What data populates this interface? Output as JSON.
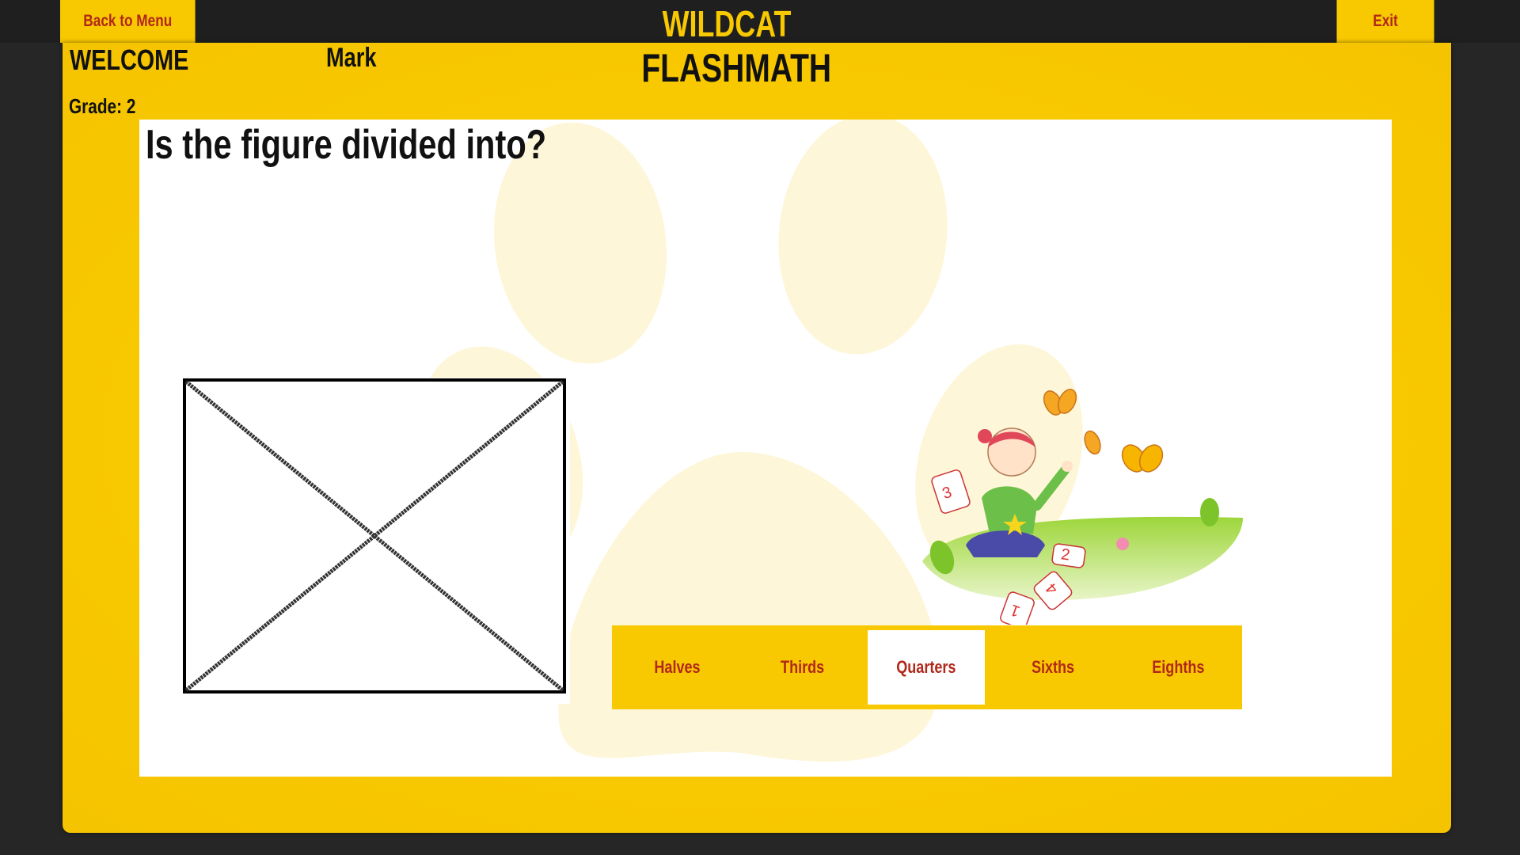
{
  "app": {
    "brand_line1": "WILDCAT",
    "brand_line2": "FLASHMATH"
  },
  "nav": {
    "back_label": "Back to Menu",
    "exit_label": "Exit"
  },
  "user": {
    "welcome_label": "WELCOME",
    "name": "Mark",
    "grade_text": "Grade: 2"
  },
  "question": {
    "prompt": "Is the figure divided into?",
    "figure_icon": "rectangle-with-diagonals-icon",
    "illustration_icon": "child-with-number-cards-icon"
  },
  "answers": [
    {
      "label": "Halves",
      "selected": false
    },
    {
      "label": "Thirds",
      "selected": false
    },
    {
      "label": "Quarters",
      "selected": true
    },
    {
      "label": "Sixths",
      "selected": false
    },
    {
      "label": "Eighths",
      "selected": false
    }
  ],
  "illustration_cards": [
    "3",
    "2",
    "1",
    "4"
  ],
  "colors": {
    "accent_yellow": "#f8c800",
    "button_text_red": "#b0281a",
    "background_dark": "#262626",
    "paw_watermark": "#fef6d8"
  }
}
